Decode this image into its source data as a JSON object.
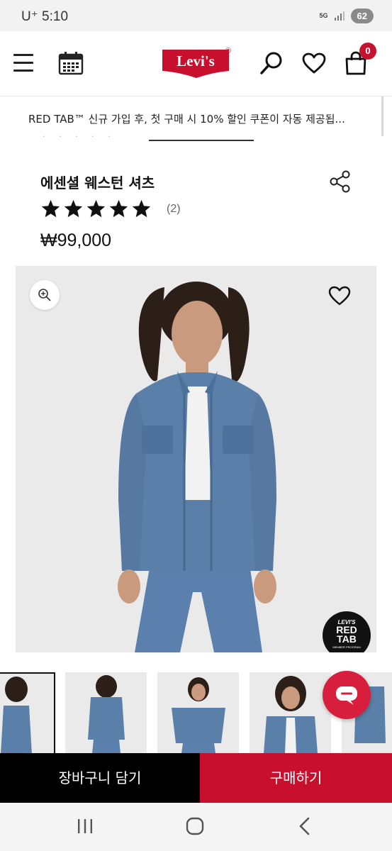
{
  "status_bar": {
    "carrier_time": "U⁺ 5:10",
    "network": "5G",
    "battery": "62"
  },
  "header": {
    "logo_text": "Levi's",
    "logo_registered": "®",
    "menu_icon": "hamburger-icon",
    "calendar_icon": "calendar-icon",
    "search_icon": "search-icon",
    "wishlist_icon": "heart-icon",
    "cart_icon": "shopping-bag-icon",
    "cart_count": "0"
  },
  "promo": {
    "text": "RED TAB™ 신규 가입 후, 첫 구매 시 10% 할인 쿠폰이 자동 제공됩..."
  },
  "product": {
    "title": "에센셜 웨스턴 셔츠",
    "rating": 5,
    "rating_max": 5,
    "review_count": "(2)",
    "price": "₩99,000"
  },
  "badge": {
    "brand": "LEVI'S",
    "name_line1": "RED",
    "name_line2": "TAB",
    "sub": "MEMBER PROGRAM"
  },
  "actions": {
    "add_to_cart": "장바구니 담기",
    "buy_now": "구매하기"
  },
  "colors": {
    "brand_red": "#c8102e",
    "black": "#000000",
    "denim": "#5a7fa8"
  }
}
